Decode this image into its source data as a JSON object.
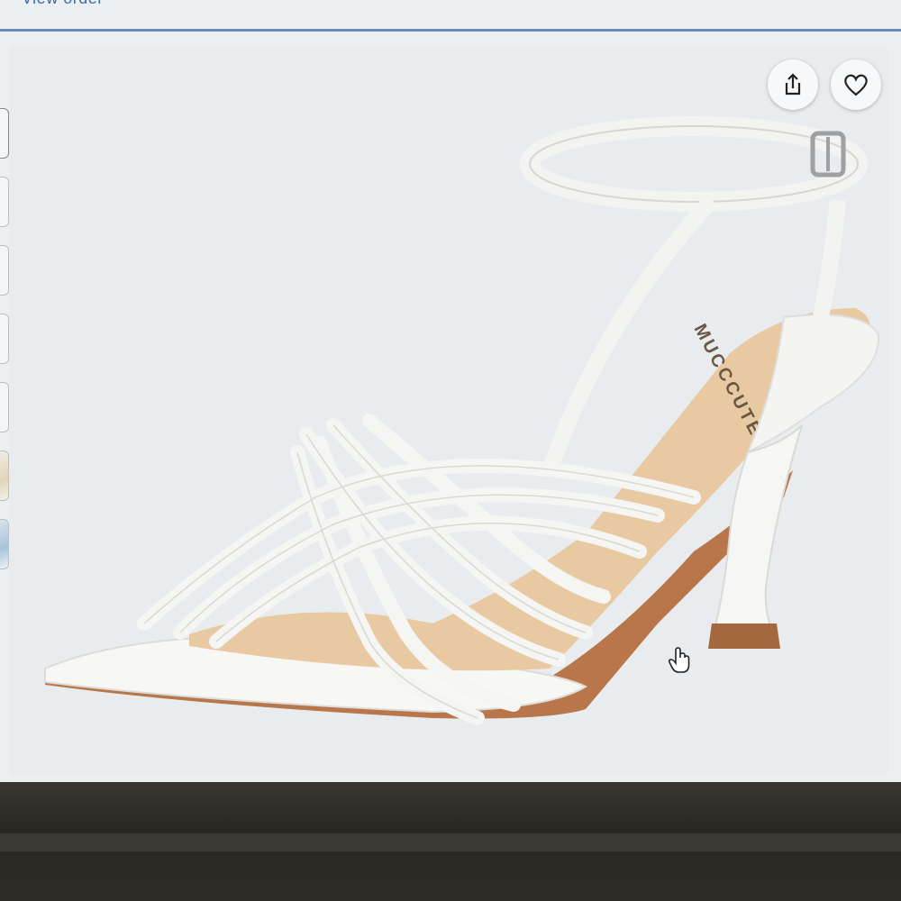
{
  "header": {
    "view_order_link": "View order"
  },
  "product": {
    "brand_print": "MUCCCUTE",
    "thumbnails": [
      "thumb-1",
      "thumb-2",
      "thumb-3",
      "thumb-4",
      "thumb-5",
      "thumb-6",
      "thumb-7"
    ]
  },
  "actions": {
    "share_icon": "share-icon",
    "wishlist_icon": "heart-icon"
  },
  "colors": {
    "link": "#3a6ea8",
    "strap": "#f6f6f4",
    "insole": "#e8c9a2",
    "sole": "#b9764a"
  }
}
